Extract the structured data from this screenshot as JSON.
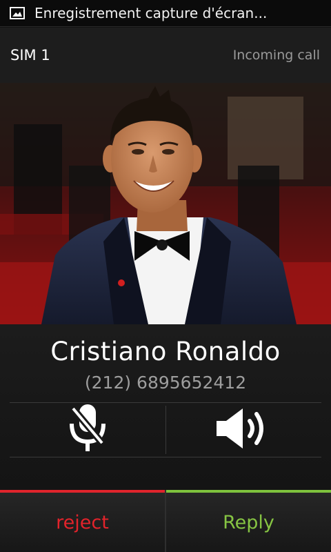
{
  "status_bar": {
    "icon": "image-icon",
    "notification": "Enregistrement capture d'écran..."
  },
  "call_header": {
    "sim": "SIM 1",
    "state": "Incoming call"
  },
  "caller": {
    "name": "Cristiano Ronaldo",
    "number": "(212) 6895652412",
    "photo": "caller-photo"
  },
  "controls": {
    "mute_icon": "mic-mute-icon",
    "speaker_icon": "speaker-icon"
  },
  "actions": {
    "reject": "reject",
    "reply": "Reply"
  },
  "colors": {
    "reject": "#e3232b",
    "reply": "#86c443"
  }
}
